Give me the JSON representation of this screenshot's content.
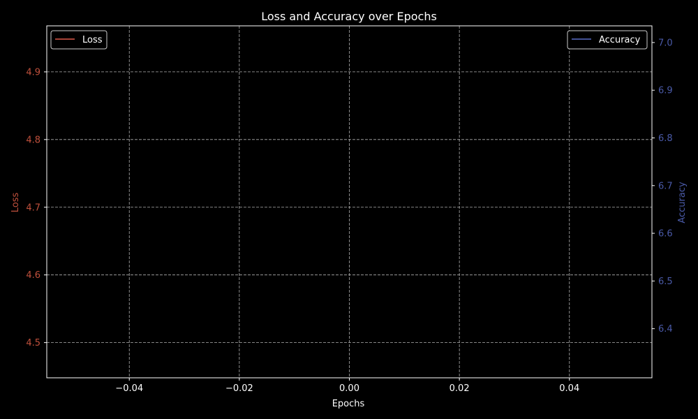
{
  "chart_data": {
    "type": "line",
    "title": "Loss and Accuracy over Epochs",
    "xlabel": "Epochs",
    "ylabel_left": "Loss",
    "ylabel_right": "Accuracy",
    "xlim": [
      -0.055,
      0.055
    ],
    "ylim_left": [
      4.448,
      4.968
    ],
    "ylim_right": [
      6.297,
      7.035
    ],
    "x_ticks": [
      -0.04,
      -0.02,
      0.0,
      0.02,
      0.04
    ],
    "x_tick_labels": [
      "−0.04",
      "−0.02",
      "0.00",
      "0.02",
      "0.04"
    ],
    "y_left_ticks": [
      4.5,
      4.6,
      4.7,
      4.8,
      4.9
    ],
    "y_left_tick_labels": [
      "4.5",
      "4.6",
      "4.7",
      "4.8",
      "4.9"
    ],
    "y_right_ticks": [
      6.4,
      6.5,
      6.6,
      6.7,
      6.8,
      6.9,
      7.0
    ],
    "y_right_tick_labels": [
      "6.4",
      "6.5",
      "6.6",
      "6.7",
      "6.8",
      "6.9",
      "7.0"
    ],
    "grid": true,
    "legend_left": {
      "placement": "top-left",
      "label": "Loss"
    },
    "legend_right": {
      "placement": "top-right",
      "label": "Accuracy"
    },
    "series": [
      {
        "name": "Loss",
        "axis": "left",
        "color": "#e05a4a",
        "x": [],
        "y": []
      },
      {
        "name": "Accuracy",
        "axis": "right",
        "color": "#5b6ec8",
        "x": [],
        "y": []
      }
    ],
    "colors": {
      "background": "#000000",
      "foreground": "#ffffff",
      "grid": "#b0b0b0",
      "loss_axis": "#c0503c",
      "accuracy_axis": "#4a5aa8"
    }
  }
}
